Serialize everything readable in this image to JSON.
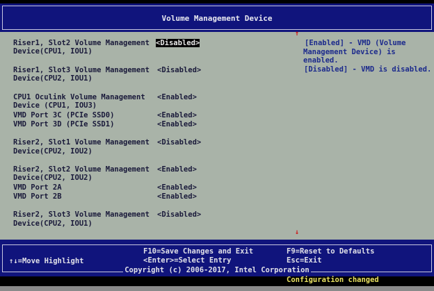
{
  "header": {
    "title": "Volume Management Device"
  },
  "settings": [
    {
      "label": [
        "Riser1, Slot2 Volume Management",
        "Device(CPU1, IOU1)"
      ],
      "value": "<Disabled>",
      "selected": true
    },
    {
      "label": [
        "Riser1, Slot3 Volume Management",
        "Device(CPU2, IOU1)"
      ],
      "value": "<Disabled>"
    },
    {
      "label": [
        "CPU1 Oculink Volume Management",
        "Device (CPU1, IOU3)"
      ],
      "value": "<Enabled>"
    },
    {
      "label": [
        "VMD Port 3C (PCIe SSD0)"
      ],
      "value": "<Enabled>"
    },
    {
      "label": [
        "VMD Port 3D (PCIe SSD1)"
      ],
      "value": "<Enabled>"
    },
    {
      "label": [
        "Riser2, Slot1 Volume Management",
        "Device(CPU2, IOU2)"
      ],
      "value": "<Disabled>"
    },
    {
      "label": [
        "Riser2, Slot2 Volume Management",
        "Device(CPU2, IOU2)"
      ],
      "value": "<Enabled>"
    },
    {
      "label": [
        "VMD Port 2A"
      ],
      "value": "<Enabled>"
    },
    {
      "label": [
        "VMD Port 2B"
      ],
      "value": "<Enabled>"
    },
    {
      "label": [
        "Riser2, Slot3 Volume Management",
        "Device(CPU2, IOU1)"
      ],
      "value": "<Disabled>"
    }
  ],
  "help": [
    "[Enabled] - VMD (Volume",
    "Management Device) is",
    "enabled.",
    "[Disabled] - VMD is disabled."
  ],
  "scroll": {
    "up": "↑",
    "down": "↓"
  },
  "footer": {
    "move": "↑↓=Move Highlight",
    "save": "F10=Save Changes and Exit",
    "select": "<Enter>=Select Entry",
    "reset": "F9=Reset to Defaults",
    "exit": "Esc=Exit",
    "copyright": "Copyright (c) 2006-2017, Intel Corporation"
  },
  "status": "Configuration changed"
}
